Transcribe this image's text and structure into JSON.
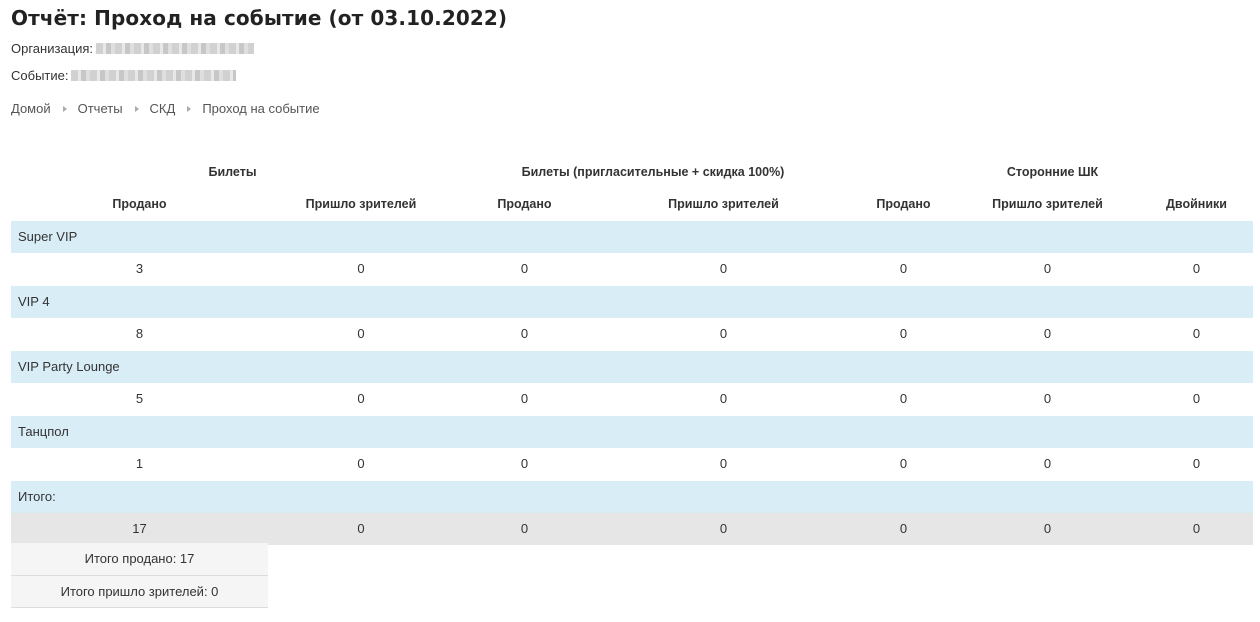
{
  "title": "Отчёт: Проход на событие (от 03.10.2022)",
  "organization": {
    "label": "Организация:"
  },
  "event": {
    "label": "Событие:"
  },
  "breadcrumb": [
    "Домой",
    "Отчеты",
    "СКД",
    "Проход на событие"
  ],
  "table": {
    "groups": [
      "Билеты",
      "Билеты (пригласительные + скидка 100%)",
      "Сторонние ШК"
    ],
    "columns": [
      "Продано",
      "Пришло зрителей",
      "Продано",
      "Пришло зрителей",
      "Продано",
      "Пришло зрителей",
      "Двойники"
    ],
    "categories": [
      {
        "name": "Super VIP",
        "values": [
          "3",
          "0",
          "0",
          "0",
          "0",
          "0",
          "0"
        ]
      },
      {
        "name": "VIP 4",
        "values": [
          "8",
          "0",
          "0",
          "0",
          "0",
          "0",
          "0"
        ]
      },
      {
        "name": "VIP Party Lounge",
        "values": [
          "5",
          "0",
          "0",
          "0",
          "0",
          "0",
          "0"
        ]
      },
      {
        "name": "Танцпол",
        "values": [
          "1",
          "0",
          "0",
          "0",
          "0",
          "0",
          "0"
        ]
      }
    ],
    "total": {
      "name": "Итого:",
      "values": [
        "17",
        "0",
        "0",
        "0",
        "0",
        "0",
        "0"
      ]
    }
  },
  "summary": {
    "sold": "Итого продано: 17",
    "attended": "Итого пришло зрителей: 0"
  },
  "colors": {
    "category_row_bg": "#d9edf7",
    "total_row_bg": "#e6e6e6",
    "summary_bg": "#f5f5f5"
  }
}
